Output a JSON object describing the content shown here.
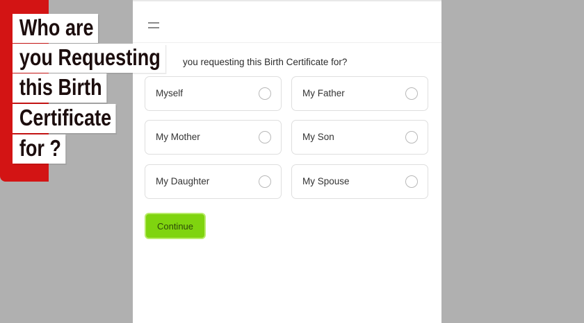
{
  "form": {
    "question": "you requesting this Birth Certificate for?",
    "options": [
      {
        "label": "Myself"
      },
      {
        "label": "My Father"
      },
      {
        "label": "My Mother"
      },
      {
        "label": "My Son"
      },
      {
        "label": "My Daughter"
      },
      {
        "label": "My Spouse"
      }
    ],
    "continue_label": "Continue"
  },
  "caption": {
    "lines": [
      "Who are",
      "you Requesting",
      "this Birth",
      "Certificate",
      "for ?"
    ]
  },
  "colors": {
    "background": "#b0b0b0",
    "accent_button": "#7fd40f",
    "caption_bar": "#d31414"
  },
  "icons": {
    "menu": "hamburger-menu-icon",
    "radio": "radio-unchecked-icon"
  }
}
